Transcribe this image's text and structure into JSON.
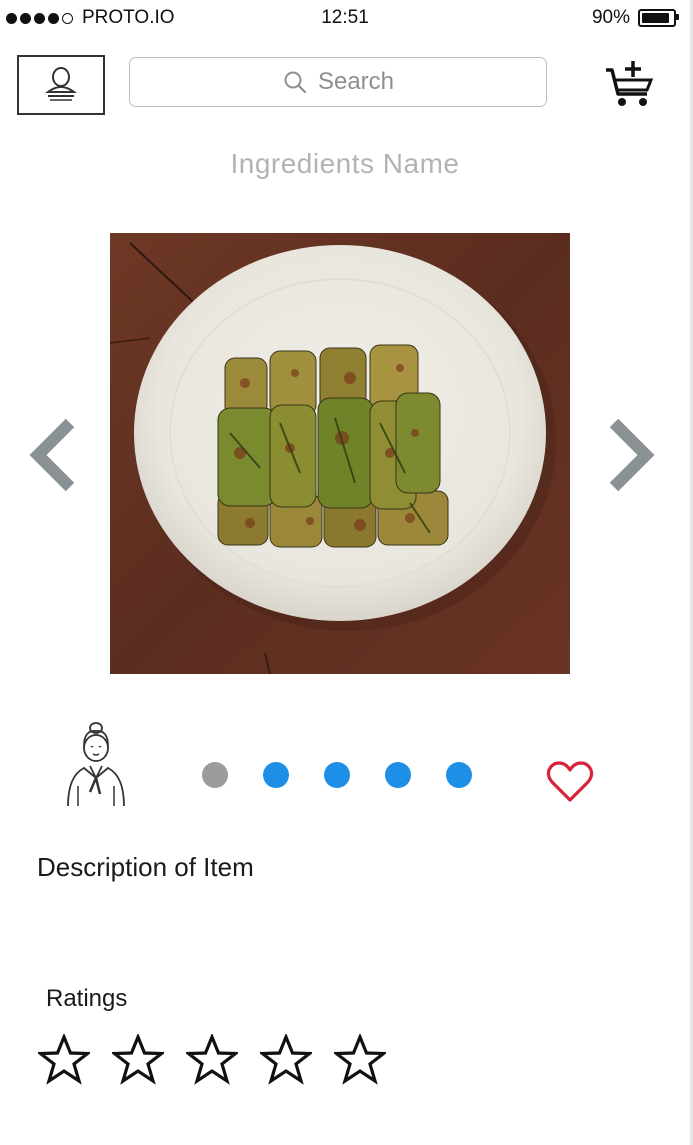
{
  "status_bar": {
    "carrier": "PROTO.IO",
    "signal_dots_filled": 4,
    "signal_dots_total": 5,
    "time": "12:51",
    "battery_percent_label": "90%",
    "battery_level": 0.9
  },
  "header": {
    "profile_icon": "user-badge-icon",
    "search_placeholder": "Search",
    "search_icon": "search-icon",
    "cart_icon": "cart-add-icon"
  },
  "product": {
    "name": "Ingredients Name",
    "image_icon": "food-photo",
    "prev_icon": "chevron-left-icon",
    "next_icon": "chevron-right-icon",
    "carousel_count": 5,
    "carousel_active_index": 0,
    "chef_icon": "chef-icon",
    "favorite_icon": "heart-icon",
    "description": "Description of Item"
  },
  "ratings": {
    "label": "Ratings",
    "max": 5,
    "value": 0
  },
  "colors": {
    "dot_active": "#9b9b9b",
    "dot_inactive": "#1e8fe6",
    "heart": "#d8243a",
    "arrow": "#8a9194"
  }
}
